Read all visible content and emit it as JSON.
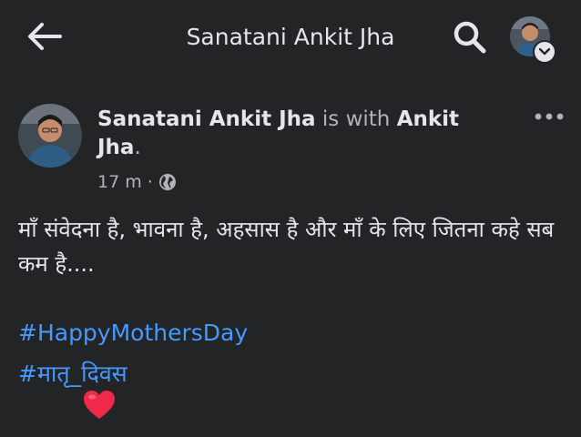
{
  "header": {
    "title": "Sanatani Ankit Jha",
    "back_icon": "back-arrow-icon",
    "search_icon": "search-icon",
    "profile_badge_icon": "chevron-down-icon"
  },
  "post": {
    "author_name": "Sanatani Ankit Jha",
    "with_text": " is with ",
    "tagged_name": "Ankit Jha",
    "tagged_suffix": ".",
    "time": "17 m",
    "separator": "·",
    "privacy_icon": "globe-icon",
    "body": "माँ संवेदना है, भावना है, अहसास है और माँ के लिए जितना कहे सब कम है....",
    "hashtags": [
      "#HappyMothersDay",
      "#मातृ_दिवस"
    ],
    "reaction_icon": "heart-icon"
  },
  "colors": {
    "background": "#232426",
    "text_primary": "#e4e6eb",
    "text_secondary": "#b0b3b8",
    "hashtag": "#4599ff",
    "heart": "#f02849"
  }
}
